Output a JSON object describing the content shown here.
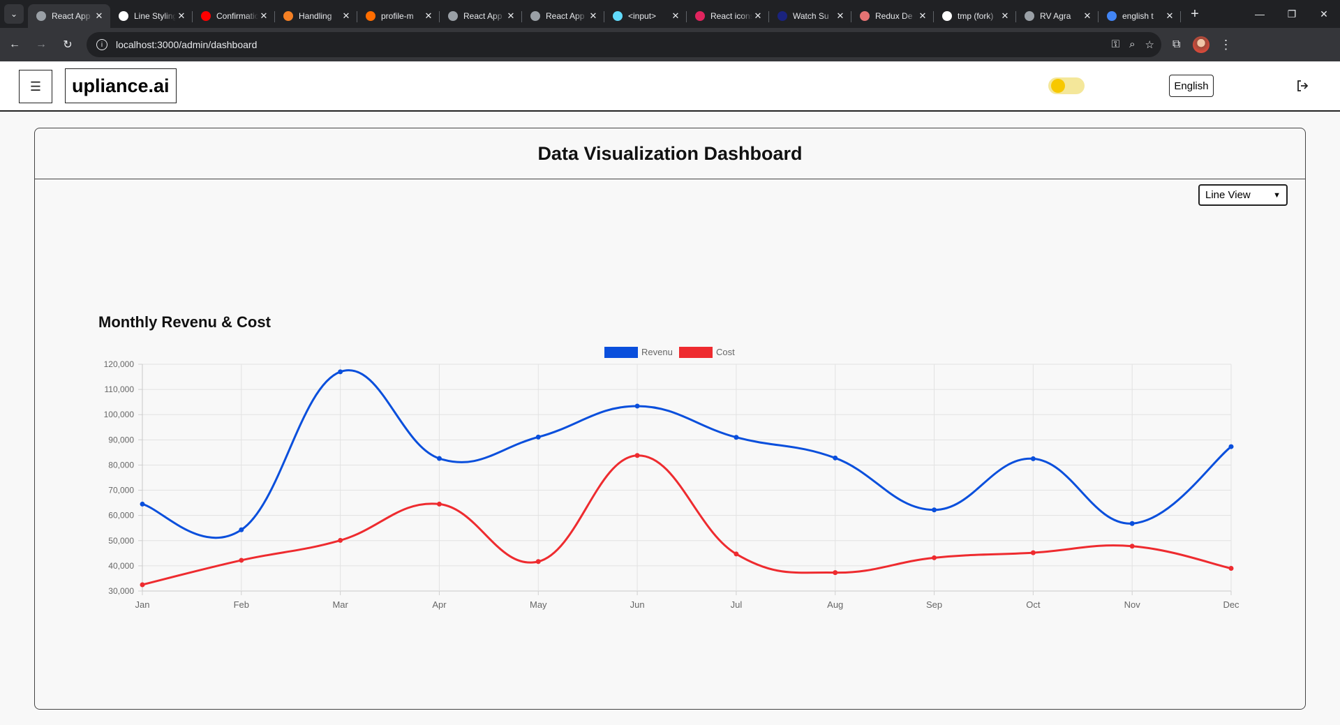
{
  "browser": {
    "tabs": [
      {
        "title": "React App",
        "icon": "globe-icon",
        "color": "#9aa0a6",
        "active": true
      },
      {
        "title": "Line Styling",
        "icon": "shield-icon",
        "color": "#ffffff"
      },
      {
        "title": "Confirmation",
        "icon": "youtube-icon",
        "color": "#ff0000"
      },
      {
        "title": "Handling",
        "icon": "stackoverflow-icon",
        "color": "#f48024"
      },
      {
        "title": "profile-m",
        "icon": "flame-icon",
        "color": "#ff6d00"
      },
      {
        "title": "React App",
        "icon": "globe-icon",
        "color": "#9aa0a6"
      },
      {
        "title": "React App",
        "icon": "globe-icon",
        "color": "#9aa0a6"
      },
      {
        "title": "<input>",
        "icon": "react-icon",
        "color": "#61dafb"
      },
      {
        "title": "React icons",
        "icon": "react-icon",
        "color": "#e0245e"
      },
      {
        "title": "Watch Su",
        "icon": "jh-icon",
        "color": "#1a237e"
      },
      {
        "title": "Redux De",
        "icon": "image-icon",
        "color": "#e57373"
      },
      {
        "title": "tmp (fork)",
        "icon": "square-icon",
        "color": "#ffffff"
      },
      {
        "title": "RV Agra",
        "icon": "globe-icon",
        "color": "#9aa0a6"
      },
      {
        "title": "english t",
        "icon": "google-icon",
        "color": "#4285f4"
      }
    ],
    "url": "localhost:3000/admin/dashboard"
  },
  "header": {
    "brand": "upliance.ai",
    "language": "English",
    "theme_toggle_on": false
  },
  "dashboard": {
    "title": "Data Visualization Dashboard",
    "view_select": "Line View"
  },
  "chart_data": {
    "type": "line",
    "title": "Monthly Revenu & Cost",
    "categories": [
      "Jan",
      "Feb",
      "Mar",
      "Apr",
      "May",
      "Jun",
      "Jul",
      "Aug",
      "Sep",
      "Oct",
      "Nov",
      "Dec"
    ],
    "series": [
      {
        "name": "Revenu",
        "color": "#0a4fdc",
        "values": [
          64500,
          54300,
          117000,
          82600,
          91100,
          103400,
          91000,
          82800,
          62200,
          82500,
          56800,
          87300
        ]
      },
      {
        "name": "Cost",
        "color": "#ee2b2f",
        "values": [
          32500,
          42200,
          50100,
          64500,
          41700,
          83800,
          44700,
          37300,
          43200,
          45200,
          47800,
          39000
        ]
      }
    ],
    "ylim": [
      30000,
      120000
    ],
    "yticks": [
      "120,000",
      "110,000",
      "100,000",
      "90,000",
      "80,000",
      "70,000",
      "60,000",
      "50,000",
      "40,000",
      "30,000"
    ],
    "legend": "top-center",
    "grid": true,
    "curve": "smooth"
  }
}
